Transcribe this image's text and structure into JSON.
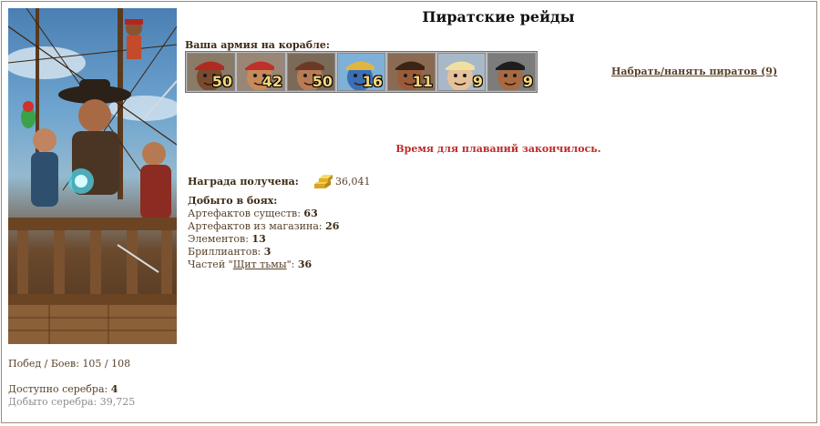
{
  "title": "Пиратские рейды",
  "army": {
    "label": "Ваша армия на корабле:",
    "units": [
      {
        "name": "red-bandana-pirate",
        "count": "50",
        "skin": "#7a4a2e",
        "hat": "#b02a22"
      },
      {
        "name": "red-scarf-pirate",
        "count": "42",
        "skin": "#c98a5b",
        "hat": "#c0302a"
      },
      {
        "name": "bearded-pirate",
        "count": "50",
        "skin": "#b87c55",
        "hat": "#6b3a26"
      },
      {
        "name": "parrot-creature",
        "count": "16",
        "skin": "#3a6fb5",
        "hat": "#e0b640"
      },
      {
        "name": "captain-pirate",
        "count": "11",
        "skin": "#9b5b3a",
        "hat": "#3a2414"
      },
      {
        "name": "blonde-sailor",
        "count": "9",
        "skin": "#e6c29b",
        "hat": "#f0e0a0"
      },
      {
        "name": "tricorn-pirate",
        "count": "9",
        "skin": "#a86a43",
        "hat": "#1e1e1e"
      }
    ]
  },
  "hire_link": "Набрать/нанять пиратов (9)",
  "sail_message": "Время для плаваний закончилось.",
  "reward": {
    "label": "Награда получена:",
    "value": "36,041",
    "icon": "gold-bars-icon"
  },
  "loot": {
    "header": "Добыто в боях:",
    "items": [
      {
        "label": "Артефактов существ: ",
        "value": "63"
      },
      {
        "label": "Артефактов из магазина: ",
        "value": "26"
      },
      {
        "label": "Элементов: ",
        "value": "13"
      },
      {
        "label": "Бриллиантов: ",
        "value": "3"
      }
    ],
    "shield": {
      "prefix": "Частей \"",
      "link": "Щит тьмы",
      "suffix": "\": ",
      "value": "36"
    }
  },
  "stats": {
    "wins_label": "Побед / Боев: ",
    "wins_value": "105 / 108",
    "silver_label": "Доступно серебра: ",
    "silver_value": "4",
    "mined_label": "Добыто серебра: ",
    "mined_value": "39,725"
  }
}
